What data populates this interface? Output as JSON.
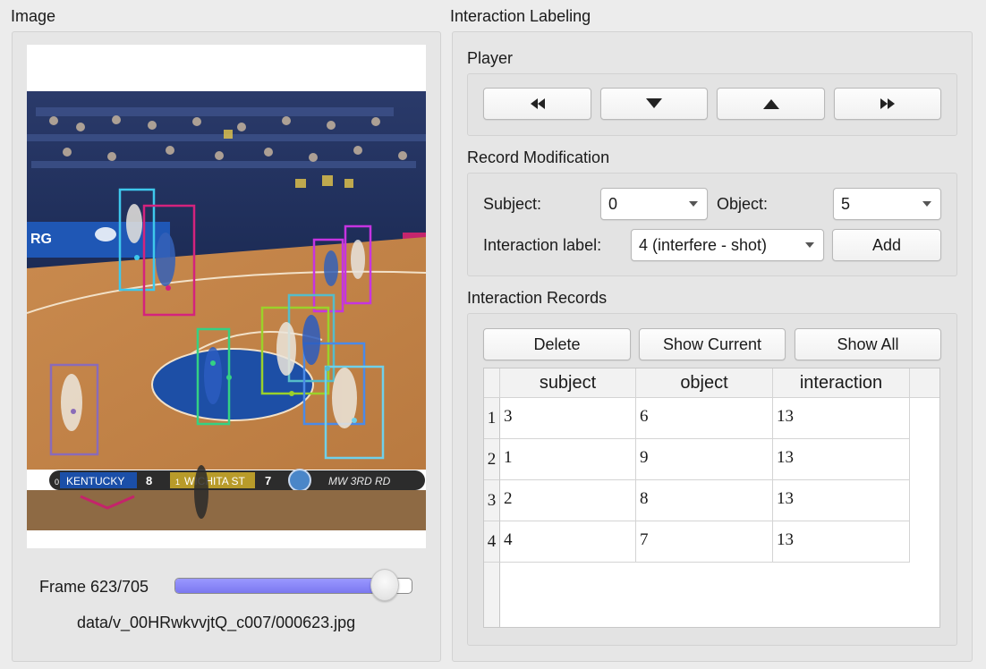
{
  "image_panel": {
    "title": "Image",
    "frame_label": "Frame 623/705",
    "frame_progress": 0.884,
    "file_path": "data/v_00HRwkvvjtQ_c007/000623.jpg",
    "scoreboard": {
      "team1_seed": "0",
      "team1": "KENTUCKY",
      "score1": "8",
      "team2_seed": "1",
      "team2": "WICHITA ST",
      "score2": "7",
      "round": "MW 3RD RD"
    },
    "banner_text": "RG",
    "detections": [
      {
        "label": "0",
        "color": "#3ec8ec"
      },
      {
        "label": "1",
        "color": "#d4237d"
      },
      {
        "label": "2",
        "color": "#c634e0"
      },
      {
        "label": "3",
        "color": "#c634e0"
      },
      {
        "label": "4",
        "color": "#34d183"
      },
      {
        "label": "5",
        "color": "#9bd12a"
      },
      {
        "label": "6",
        "color": "#56bcc9"
      },
      {
        "label": "7",
        "color": "#8a6bb8"
      },
      {
        "label": "8",
        "color": "#4a8ae8"
      },
      {
        "label": "9",
        "color": "#6fd0ea"
      }
    ]
  },
  "labeling_panel": {
    "title": "Interaction Labeling",
    "player": {
      "title": "Player",
      "buttons": [
        "rewind-icon",
        "down-triangle-icon",
        "up-triangle-icon",
        "fast-forward-icon"
      ]
    },
    "record_modification": {
      "title": "Record Modification",
      "subject_label": "Subject:",
      "subject_value": "0",
      "object_label": "Object:",
      "object_value": "5",
      "interaction_label": "Interaction label:",
      "interaction_value": "4 (interfere - shot)",
      "add_label": "Add"
    },
    "records": {
      "title": "Interaction Records",
      "delete_label": "Delete",
      "show_current_label": "Show Current",
      "show_all_label": "Show All",
      "columns": [
        "subject",
        "object",
        "interaction"
      ],
      "rows": [
        {
          "index": "1",
          "subject": "3",
          "object": "6",
          "interaction": "13"
        },
        {
          "index": "2",
          "subject": "1",
          "object": "9",
          "interaction": "13"
        },
        {
          "index": "3",
          "subject": "2",
          "object": "8",
          "interaction": "13"
        },
        {
          "index": "4",
          "subject": "4",
          "object": "7",
          "interaction": "13"
        }
      ]
    }
  }
}
